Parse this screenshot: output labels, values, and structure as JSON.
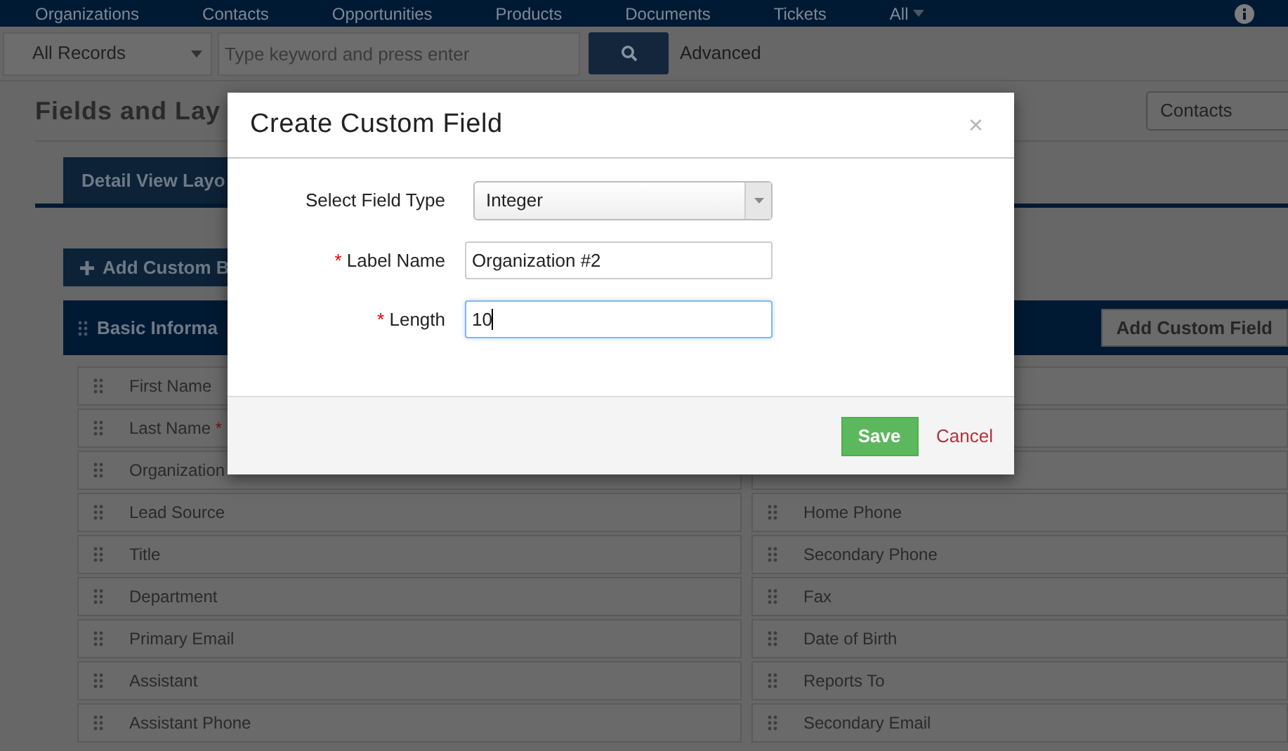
{
  "nav": {
    "items": [
      "Organizations",
      "Contacts",
      "Opportunities",
      "Products",
      "Documents",
      "Tickets",
      "All"
    ]
  },
  "search": {
    "scope": "All Records",
    "placeholder": "Type keyword and press enter",
    "advanced": "Advanced"
  },
  "page": {
    "title": "Fields and Lay",
    "module": "Contacts",
    "tab": "Detail View Layo",
    "add_block": "Add Custom B"
  },
  "block": {
    "title": "Basic Informa",
    "add_field": "Add Custom Field",
    "left_fields": [
      {
        "label": "First Name"
      },
      {
        "label": "Last Name",
        "required_mark": "*"
      },
      {
        "label": "Organization"
      },
      {
        "label": "Lead Source"
      },
      {
        "label": "Title"
      },
      {
        "label": "Department"
      },
      {
        "label": "Primary Email"
      },
      {
        "label": "Assistant"
      },
      {
        "label": "Assistant Phone"
      }
    ],
    "right_fields": [
      {
        "label": "Home Phone"
      },
      {
        "label": "Secondary Phone"
      },
      {
        "label": "Fax"
      },
      {
        "label": "Date of Birth"
      },
      {
        "label": "Reports To"
      },
      {
        "label": "Secondary Email"
      }
    ]
  },
  "modal": {
    "title": "Create Custom Field",
    "close": "×",
    "fields": [
      {
        "kind": "select",
        "label": "Select Field Type",
        "value": "Integer",
        "focused": false
      },
      {
        "kind": "text",
        "label": "Label Name",
        "required_mark": "*",
        "value": "Organization #2",
        "focused": false
      },
      {
        "kind": "text",
        "label": "Length",
        "required_mark": "*",
        "value": "10",
        "focused": true
      }
    ],
    "save": "Save",
    "cancel": "Cancel"
  }
}
